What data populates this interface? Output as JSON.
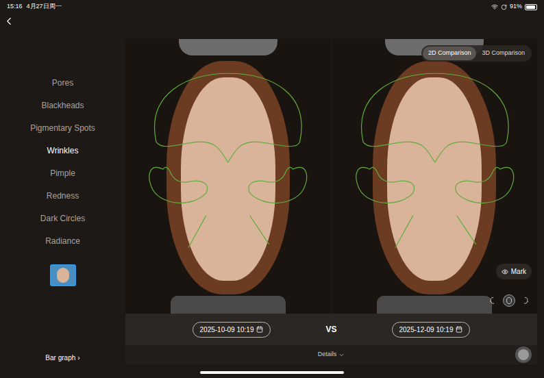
{
  "status_bar": {
    "time": "15:16",
    "date": "4月27日周一",
    "battery": "91%",
    "battery_level": 0.91
  },
  "sidebar": {
    "items": [
      {
        "label": "Pores",
        "selected": false
      },
      {
        "label": "Blackheads",
        "selected": false
      },
      {
        "label": "Pigmentary Spots",
        "selected": false
      },
      {
        "label": "Wrinkles",
        "selected": true
      },
      {
        "label": "Pimple",
        "selected": false
      },
      {
        "label": "Redness",
        "selected": false
      },
      {
        "label": "Dark Circles",
        "selected": false
      },
      {
        "label": "Radiance",
        "selected": false
      }
    ],
    "thumbnail": {
      "selected": true
    },
    "bar_graph": {
      "label": "Bar graph",
      "arrow": "›"
    }
  },
  "view_toggle": [
    {
      "label": "2D Comparison",
      "selected": true
    },
    {
      "label": "3D Comparison",
      "selected": false
    }
  ],
  "mark_button": {
    "label": "Mark"
  },
  "face_views": [
    {
      "selected": false
    },
    {
      "selected": true
    },
    {
      "selected": false
    }
  ],
  "comparison": {
    "left_date": "2025-10-09 10:19",
    "vs": "VS",
    "right_date": "2025-12-09 10:19"
  },
  "details": {
    "label": "Details"
  }
}
